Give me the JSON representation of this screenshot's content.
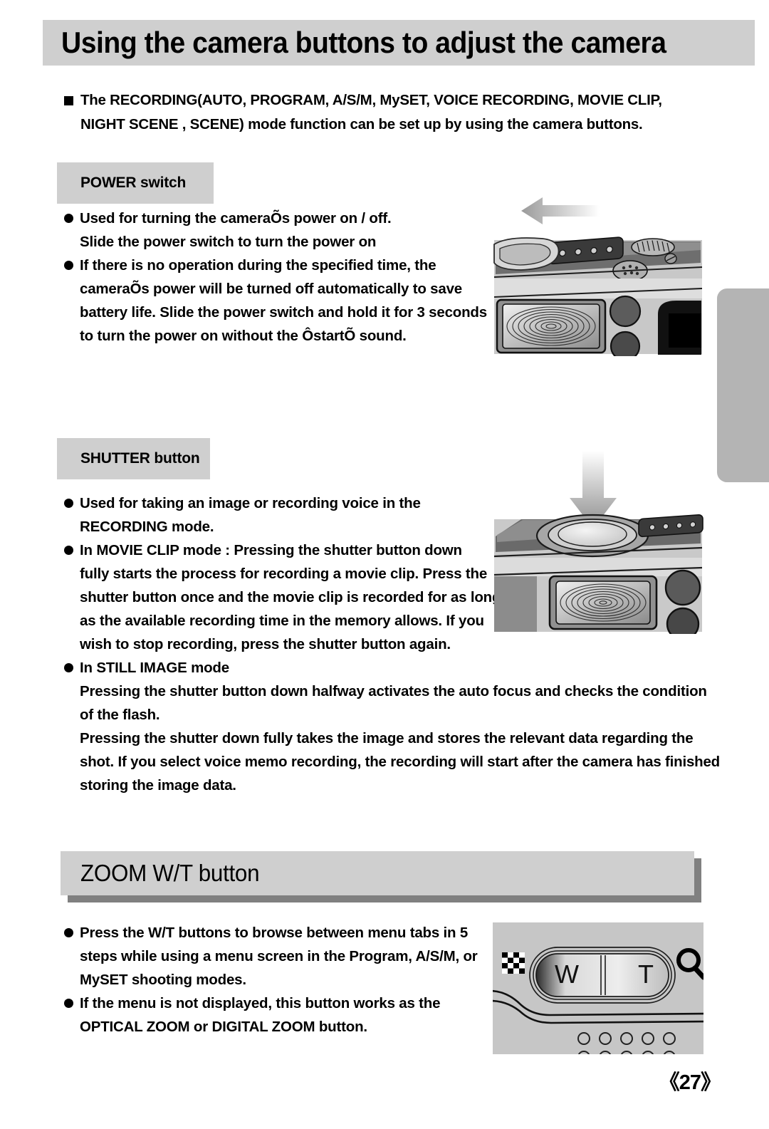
{
  "page": {
    "title": "Using the camera buttons to adjust the camera",
    "number": "《27》"
  },
  "intro": {
    "line1": "The RECORDING(AUTO, PROGRAM, A/S/M, MySET, VOICE RECORDING, MOVIE CLIP,",
    "line2": "NIGHT SCENE , SCENE) mode function can be set up by using the camera buttons."
  },
  "sections": {
    "power": {
      "label": "POWER switch",
      "bullets": [
        {
          "lines": [
            "Used for turning the cameraÕs power on / off.",
            "Slide the power switch to turn the power on"
          ]
        },
        {
          "lines": [
            "If there is no operation during the specified time, the",
            "cameraÕs power will be turned off automatically to save",
            "battery life. Slide the power switch and hold it for 3 seconds",
            "to turn the power on without the ÔstartÕ sound."
          ]
        }
      ]
    },
    "shutter": {
      "label": "SHUTTER button",
      "bullets": [
        {
          "lines": [
            "Used for taking an image or recording voice in the",
            "RECORDING mode."
          ]
        },
        {
          "lines": [
            "In MOVIE CLIP mode : Pressing the shutter button down",
            "fully starts the process for recording a movie clip. Press the",
            "shutter button once and the movie clip is recorded for as long",
            "as the available recording time in the memory allows. If you",
            "wish to stop recording, press the shutter button again."
          ]
        },
        {
          "lines": [
            "In STILL IMAGE mode",
            "Pressing the shutter button down halfway activates the auto focus and checks the condition",
            "of the flash.",
            "Pressing the shutter down fully takes the image and stores the relevant data regarding the",
            "shot. If you select voice memo recording, the recording will start after the camera has finished",
            "storing the image data."
          ]
        }
      ]
    },
    "zoom": {
      "label": "ZOOM W/T button",
      "bullets": [
        {
          "lines": [
            "Press the W/T buttons to browse between menu tabs in 5",
            "steps while using a menu screen in the Program, A/S/M, or",
            "MySET shooting modes."
          ]
        },
        {
          "lines": [
            "If the menu is not displayed, this button works as the",
            "OPTICAL ZOOM or DIGITAL ZOOM button."
          ]
        }
      ]
    }
  },
  "illustrations": {
    "power": {
      "name": "camera-top-power-switch",
      "arrow": "left-arrow"
    },
    "shutter": {
      "name": "camera-top-shutter-button",
      "arrow": "down-arrow"
    },
    "zoom": {
      "name": "camera-back-zoom-rocker",
      "wide_label": "W",
      "tele_label": "T",
      "wide_icon": "checkerboard-icon",
      "tele_icon": "magnifier-icon"
    }
  },
  "colors": {
    "chip_gray": "#cfcfcf",
    "band_shadow_gray": "#808080",
    "tab_gray": "#b4b4b4",
    "illustration_bg": "#c6c6c6"
  }
}
